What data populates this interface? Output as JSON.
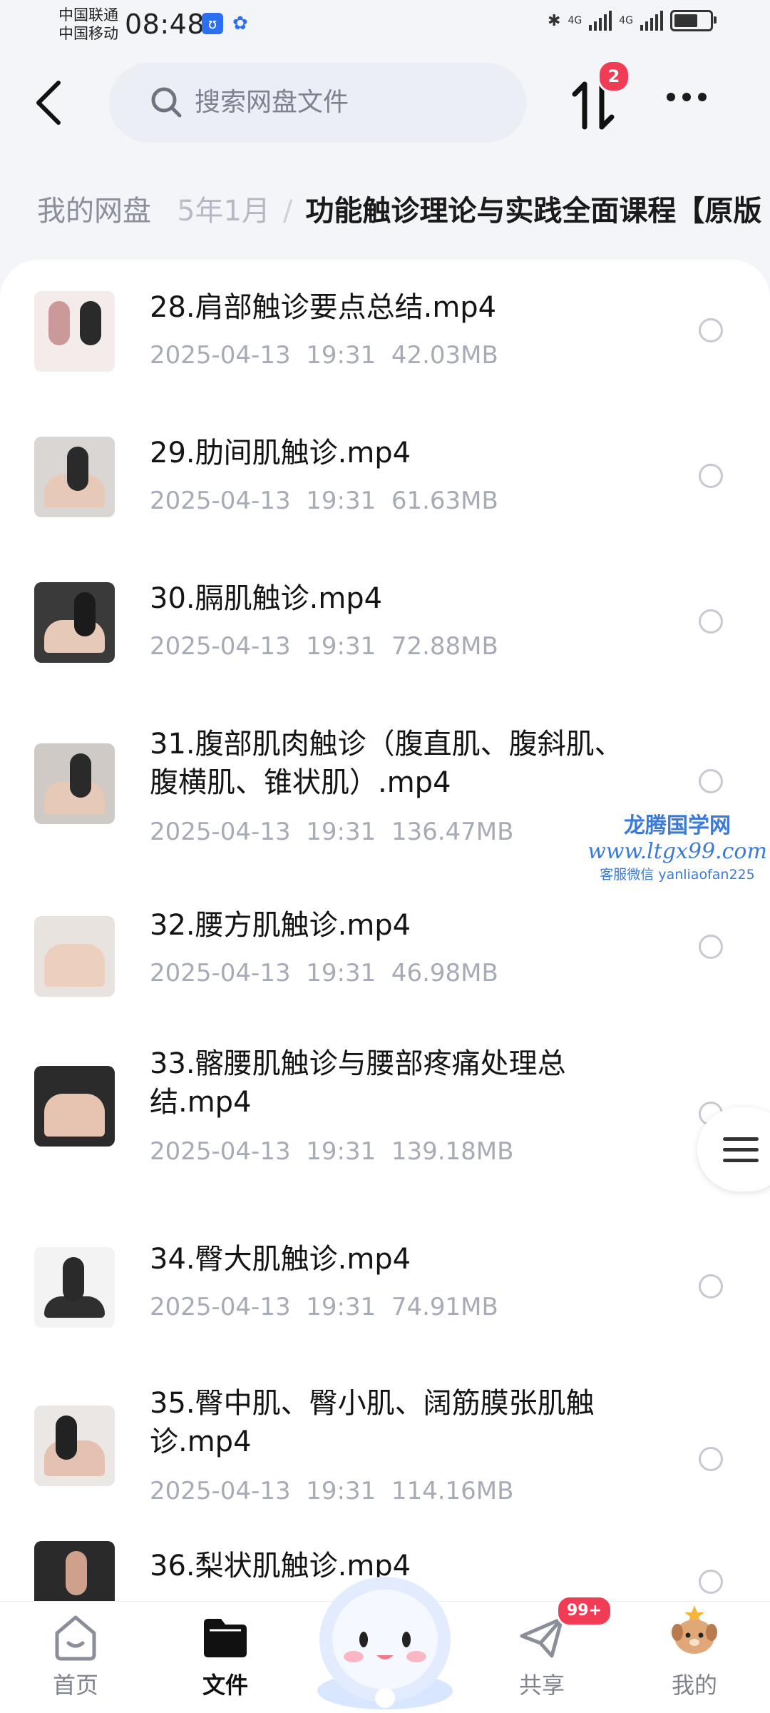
{
  "status_bar": {
    "carrier1": "中国联通",
    "carrier2": "中国移动",
    "time": "08:48",
    "network1": "4G",
    "network2": "4G"
  },
  "header": {
    "search_placeholder": "搜索网盘文件",
    "transfer_badge": "2"
  },
  "breadcrumb": {
    "home": "我的网盘",
    "segment": "5年1月",
    "current": "功能触诊理论与实践全面课程【原版"
  },
  "files": [
    {
      "name": "28.肩部触诊要点总结.mp4",
      "date": "2025-04-13",
      "time": "19:31",
      "size": "42.03MB"
    },
    {
      "name": "29.肋间肌触诊.mp4",
      "date": "2025-04-13",
      "time": "19:31",
      "size": "61.63MB"
    },
    {
      "name": "30.膈肌触诊.mp4",
      "date": "2025-04-13",
      "time": "19:31",
      "size": "72.88MB"
    },
    {
      "name": "31.腹部肌肉触诊（腹直肌、腹斜肌、腹横肌、锥状肌）.mp4",
      "date": "2025-04-13",
      "time": "19:31",
      "size": "136.47MB"
    },
    {
      "name": "32.腰方肌触诊.mp4",
      "date": "2025-04-13",
      "time": "19:31",
      "size": "46.98MB"
    },
    {
      "name": "33.髂腰肌触诊与腰部疼痛处理总结.mp4",
      "date": "2025-04-13",
      "time": "19:31",
      "size": "139.18MB"
    },
    {
      "name": "34.臀大肌触诊.mp4",
      "date": "2025-04-13",
      "time": "19:31",
      "size": "74.91MB"
    },
    {
      "name": "35.臀中肌、臀小肌、阔筋膜张肌触诊.mp4",
      "date": "2025-04-13",
      "time": "19:31",
      "size": "114.16MB"
    },
    {
      "name": "36.梨状肌触诊.mp4",
      "date": "",
      "time": "",
      "size": ""
    }
  ],
  "watermark": {
    "line1": "龙腾国学网",
    "line2": "www.ltgx99.com",
    "line3": "客服微信 yanliaofan225"
  },
  "bottom_nav": {
    "home": "首页",
    "files": "文件",
    "share": "共享",
    "share_badge": "99+",
    "mine": "我的"
  },
  "colors": {
    "accent_badge": "#f23c56",
    "background": "#f4f5f9",
    "meta_text": "#a7abb6"
  }
}
